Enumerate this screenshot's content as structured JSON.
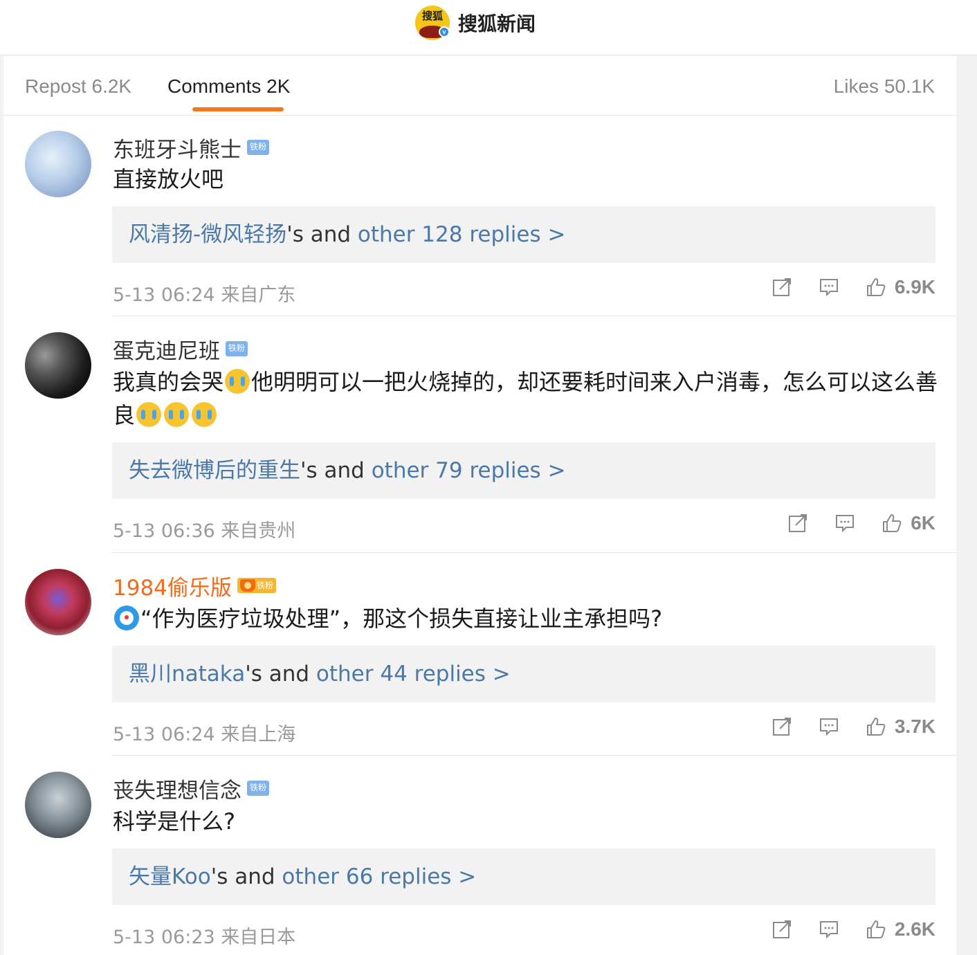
{
  "header": {
    "logo_text": "搜狐",
    "title": "搜狐新闻",
    "verified_mark": "v"
  },
  "tabs": {
    "repost": "Repost 6.2K",
    "comments": "Comments 2K",
    "likes": "Likes 50.1K",
    "active": "comments",
    "accent_color": "#f27a1c"
  },
  "comments": [
    {
      "username": "东班牙斗熊士",
      "badge": "铁粉",
      "vip": false,
      "text": "直接放火吧",
      "reply_user": "风清扬-微风轻扬",
      "reply_mid": "'s and ",
      "reply_more": "other 128 replies >",
      "meta": "5-13 06:24 来自广东",
      "likes": "6.9K"
    },
    {
      "username": "蛋克迪尼班",
      "badge": "铁粉",
      "vip": false,
      "text_a": "我真的会哭",
      "text_b": "他明明可以一把火烧掉的，却还要耗时间来入户消毒，怎么可以这么善良",
      "emoji": "crying-emoji",
      "reply_user": "失去微博后的重生",
      "reply_mid": "'s and ",
      "reply_more": "other 79 replies >",
      "meta": "5-13 06:36 来自贵州",
      "likes": "6K"
    },
    {
      "username": "1984偷乐版",
      "badge": "铁粉",
      "vip": true,
      "text": "“作为医疗垃圾处理”，那这个损失直接让业主承担吗?",
      "emoji": "doraemon-emoji",
      "reply_user": "黑川nataka",
      "reply_mid": "'s and ",
      "reply_more": "other 44 replies >",
      "meta": "5-13 06:24 来自上海",
      "likes": "3.7K"
    },
    {
      "username": "丧失理想信念",
      "badge": "铁粉",
      "vip": false,
      "text": "科学是什么?",
      "reply_user": "矢量Koo",
      "reply_mid": "'s and ",
      "reply_more": "other 66 replies >",
      "meta": "5-13 06:23 来自日本",
      "likes": "2.6K"
    }
  ]
}
